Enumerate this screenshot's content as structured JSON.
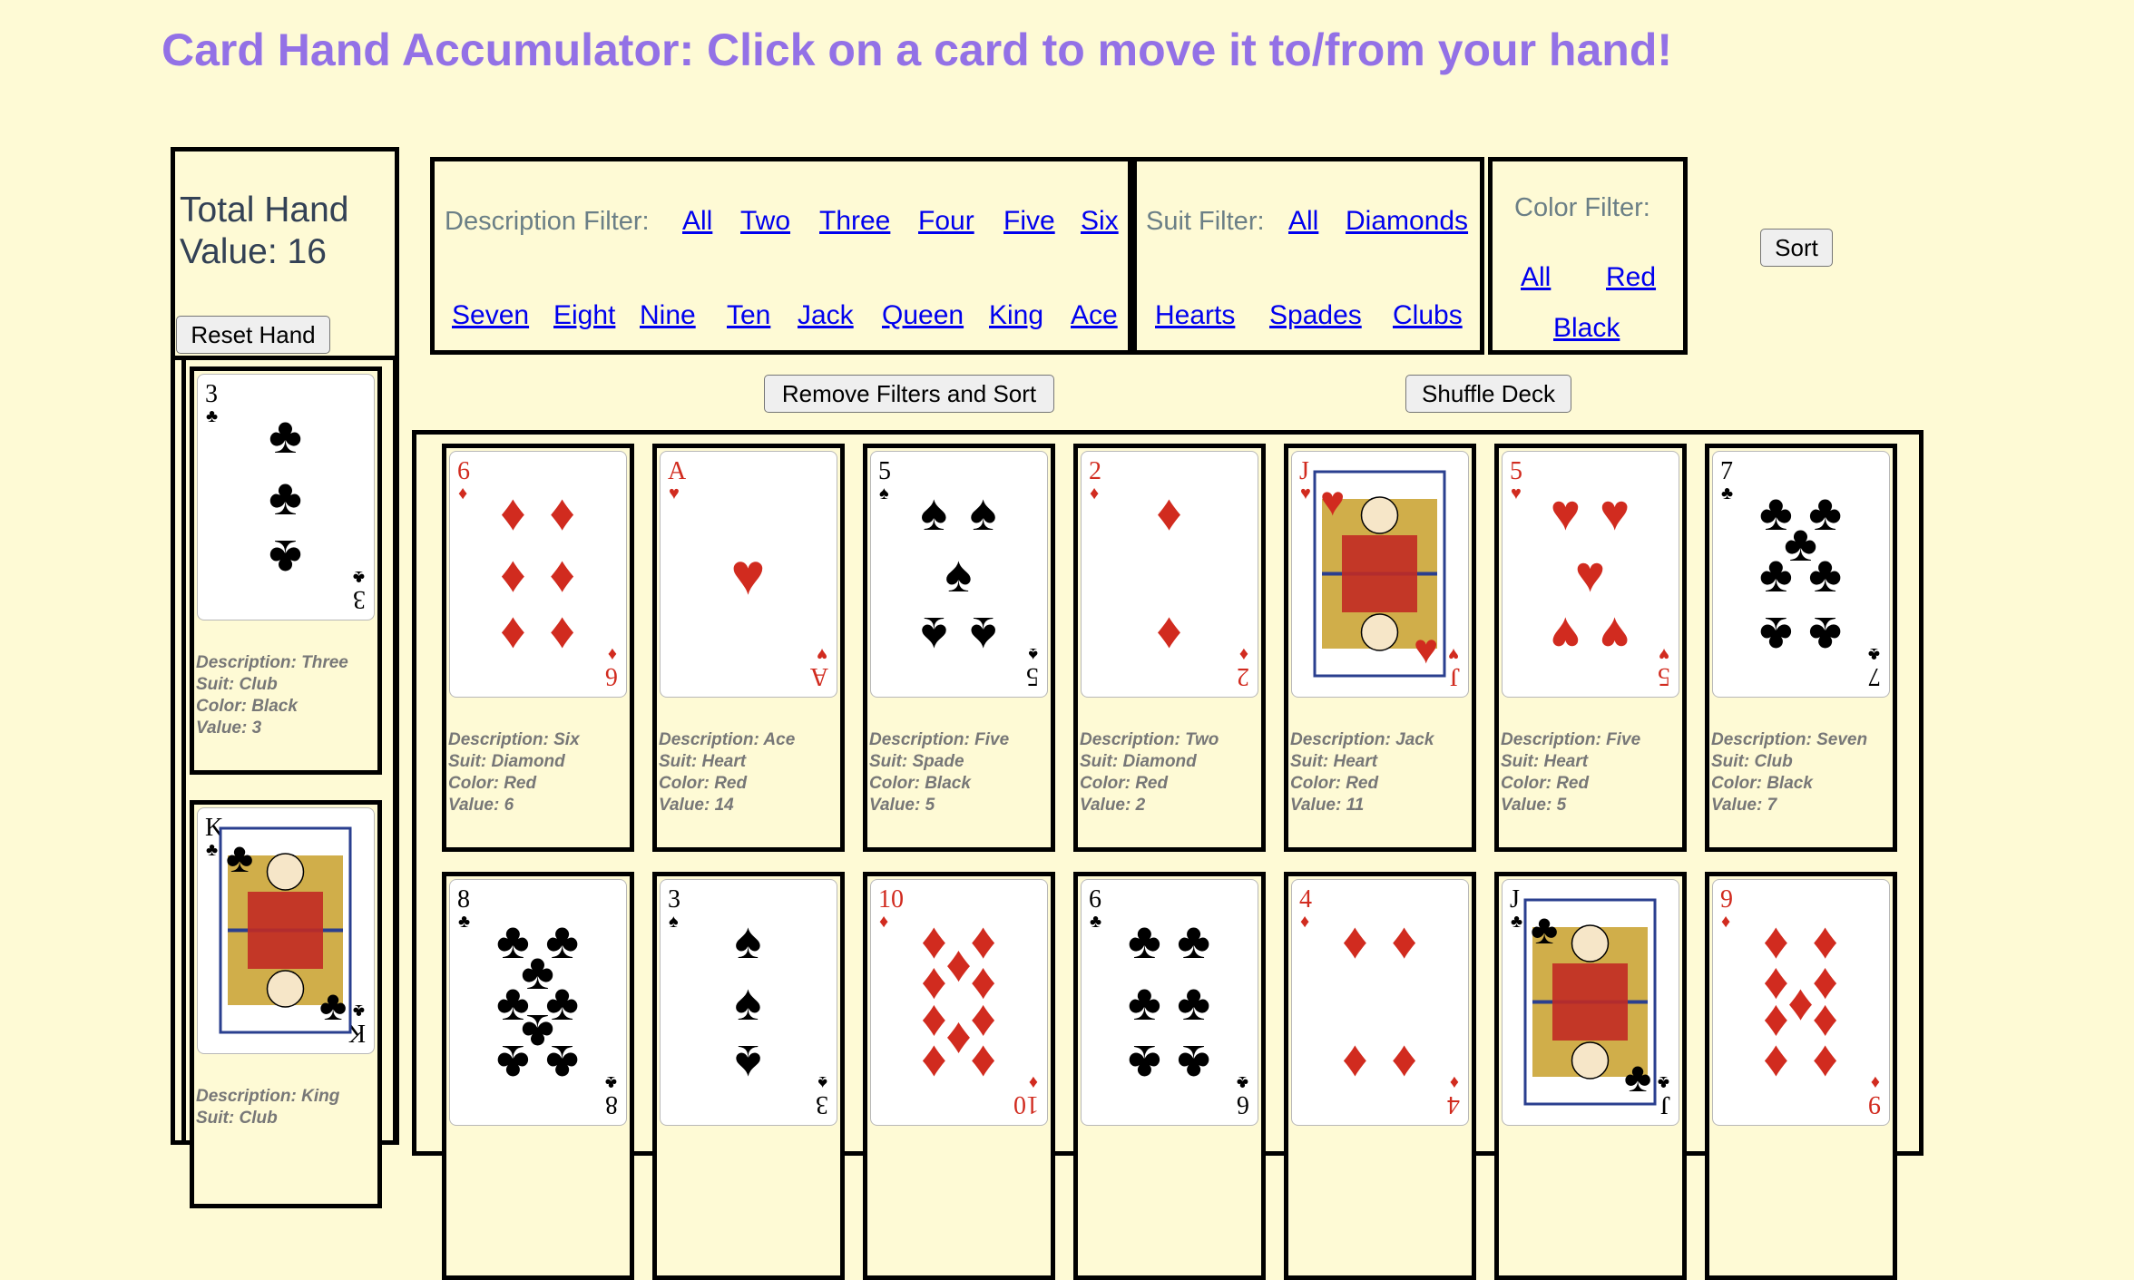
{
  "title": "Card Hand Accumulator: Click on a card to move it to/from your hand!",
  "hand": {
    "total_label": "Total Hand Value: 16",
    "reset_button": "Reset Hand",
    "cards": [
      {
        "rank": "3",
        "suit": "club",
        "color": "black",
        "pips": 3,
        "face": false,
        "desc": "Description: Three",
        "suit_text": "Suit: Club",
        "color_text": "Color: Black",
        "value_text": "Value: 3"
      },
      {
        "rank": "K",
        "suit": "club",
        "color": "black",
        "pips": 0,
        "face": true,
        "desc": "Description: King",
        "suit_text": "Suit: Club",
        "color_text": "",
        "value_text": ""
      }
    ]
  },
  "filters": {
    "description": {
      "label": "Description Filter:",
      "options": [
        "All",
        "Two",
        "Three",
        "Four",
        "Five",
        "Six",
        "Seven",
        "Eight",
        "Nine",
        "Ten",
        "Jack",
        "Queen",
        "King",
        "Ace"
      ]
    },
    "suit": {
      "label": "Suit Filter:",
      "options": [
        "All",
        "Diamonds",
        "Hearts",
        "Spades",
        "Clubs"
      ]
    },
    "color": {
      "label": "Color Filter:",
      "options": [
        "All",
        "Red",
        "Black"
      ]
    }
  },
  "buttons": {
    "sort": "Sort",
    "remove_filters": "Remove Filters and Sort",
    "shuffle": "Shuffle Deck"
  },
  "deck": [
    {
      "rank": "6",
      "suit": "diamond",
      "color": "red",
      "pips": 6,
      "face": false,
      "desc": "Description: Six",
      "suit_text": "Suit: Diamond",
      "color_text": "Color: Red",
      "value_text": "Value: 6"
    },
    {
      "rank": "A",
      "suit": "heart",
      "color": "red",
      "pips": 1,
      "face": false,
      "desc": "Description: Ace",
      "suit_text": "Suit: Heart",
      "color_text": "Color: Red",
      "value_text": "Value: 14"
    },
    {
      "rank": "5",
      "suit": "spade",
      "color": "black",
      "pips": 5,
      "face": false,
      "desc": "Description: Five",
      "suit_text": "Suit: Spade",
      "color_text": "Color: Black",
      "value_text": "Value: 5"
    },
    {
      "rank": "2",
      "suit": "diamond",
      "color": "red",
      "pips": 2,
      "face": false,
      "desc": "Description: Two",
      "suit_text": "Suit: Diamond",
      "color_text": "Color: Red",
      "value_text": "Value: 2"
    },
    {
      "rank": "J",
      "suit": "heart",
      "color": "red",
      "pips": 0,
      "face": true,
      "desc": "Description: Jack",
      "suit_text": "Suit: Heart",
      "color_text": "Color: Red",
      "value_text": "Value: 11"
    },
    {
      "rank": "5",
      "suit": "heart",
      "color": "red",
      "pips": 5,
      "face": false,
      "desc": "Description: Five",
      "suit_text": "Suit: Heart",
      "color_text": "Color: Red",
      "value_text": "Value: 5"
    },
    {
      "rank": "7",
      "suit": "club",
      "color": "black",
      "pips": 7,
      "face": false,
      "desc": "Description: Seven",
      "suit_text": "Suit: Club",
      "color_text": "Color: Black",
      "value_text": "Value: 7"
    },
    {
      "rank": "8",
      "suit": "club",
      "color": "black",
      "pips": 8,
      "face": false,
      "desc": "",
      "suit_text": "",
      "color_text": "",
      "value_text": ""
    },
    {
      "rank": "3",
      "suit": "spade",
      "color": "black",
      "pips": 3,
      "face": false,
      "desc": "",
      "suit_text": "",
      "color_text": "",
      "value_text": ""
    },
    {
      "rank": "10",
      "suit": "diamond",
      "color": "red",
      "pips": 10,
      "face": false,
      "desc": "",
      "suit_text": "",
      "color_text": "",
      "value_text": ""
    },
    {
      "rank": "6",
      "suit": "club",
      "color": "black",
      "pips": 6,
      "face": false,
      "desc": "",
      "suit_text": "",
      "color_text": "",
      "value_text": ""
    },
    {
      "rank": "4",
      "suit": "diamond",
      "color": "red",
      "pips": 4,
      "face": false,
      "desc": "",
      "suit_text": "",
      "color_text": "",
      "value_text": ""
    },
    {
      "rank": "J",
      "suit": "club",
      "color": "black",
      "pips": 0,
      "face": true,
      "desc": "",
      "suit_text": "",
      "color_text": "",
      "value_text": ""
    },
    {
      "rank": "9",
      "suit": "diamond",
      "color": "red",
      "pips": 9,
      "face": false,
      "desc": "",
      "suit_text": "",
      "color_text": "",
      "value_text": ""
    }
  ],
  "colors": {
    "background": "#fefad5",
    "title": "#9371e6",
    "red_suit": "#d12b1f",
    "black_suit": "#000000",
    "link": "#0000ee"
  }
}
